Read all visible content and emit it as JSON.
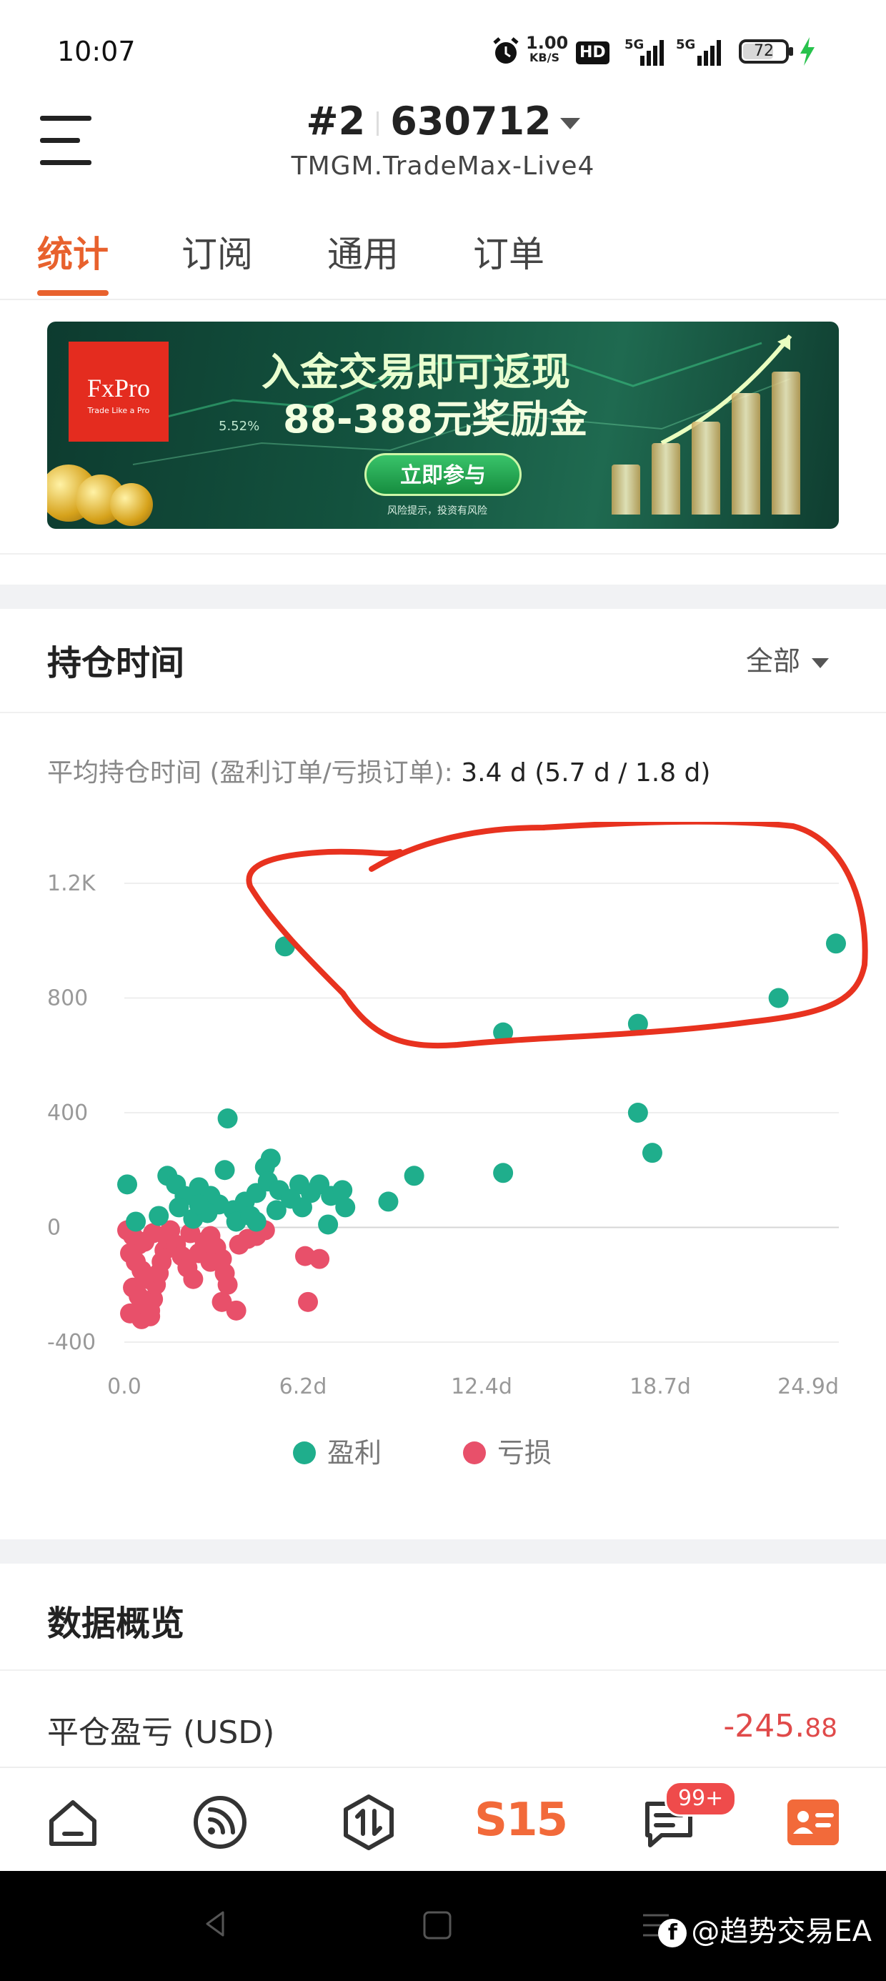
{
  "status_bar": {
    "time": "10:07",
    "net_speed_top": "1.00",
    "net_speed_unit": "KB/S",
    "hd_label": "HD",
    "signal1_label": "5G",
    "signal2_label": "5G",
    "battery": "72",
    "battery_level": 0.72,
    "icons": [
      "alarm-icon",
      "hd-icon",
      "signal-icon",
      "signal-icon",
      "battery-icon",
      "charging-icon"
    ]
  },
  "header": {
    "account_prefix": "#2",
    "account_number": "630712",
    "server": "TMGM.TradeMax-Live4"
  },
  "tabs": [
    {
      "label": "统计",
      "active": true
    },
    {
      "label": "订阅",
      "active": false
    },
    {
      "label": "通用",
      "active": false
    },
    {
      "label": "订单",
      "active": false
    }
  ],
  "banner": {
    "brand": "FxPro",
    "brand_tagline": "Trade Like a Pro",
    "headline1": "入金交易即可返现",
    "headline2": "88-388元奖励金",
    "percent_text": "5.52%",
    "cta": "立即参与",
    "risk_note": "风险提示，投资有风险"
  },
  "holding_time": {
    "title": "持仓时间",
    "filter": "全部",
    "avg_label": "平均持仓时间 (盈利订单/亏损订单):",
    "avg_value": "3.4 d (5.7 d / 1.8 d)"
  },
  "chart_data": {
    "type": "scatter",
    "x_ticks": [
      "0.0",
      "6.2d",
      "12.4d",
      "18.7d",
      "24.9d"
    ],
    "y_ticks": [
      "1.2K",
      "800",
      "400",
      "0",
      "-400"
    ],
    "xlim": [
      0,
      24.9
    ],
    "ylim": [
      -400,
      1200
    ],
    "grid": true,
    "legend_position": "bottom",
    "colors": {
      "profit": "#1fae8c",
      "loss": "#e8506a",
      "annotation": "#e8321f"
    },
    "series": [
      {
        "name": "盈利",
        "points": [
          [
            5.6,
            980
          ],
          [
            13.2,
            680
          ],
          [
            17.9,
            710
          ],
          [
            22.8,
            800
          ],
          [
            24.8,
            990
          ],
          [
            17.9,
            400
          ],
          [
            18.4,
            260
          ],
          [
            13.2,
            190
          ],
          [
            10.1,
            180
          ],
          [
            9.2,
            90
          ],
          [
            3.6,
            380
          ],
          [
            0.1,
            150
          ],
          [
            3.5,
            200
          ],
          [
            5.1,
            240
          ],
          [
            4.9,
            210
          ],
          [
            1.5,
            180
          ],
          [
            1.8,
            150
          ],
          [
            2.1,
            110
          ],
          [
            2.6,
            140
          ],
          [
            3.0,
            110
          ],
          [
            3.3,
            80
          ],
          [
            3.8,
            60
          ],
          [
            4.2,
            90
          ],
          [
            4.6,
            120
          ],
          [
            5.0,
            160
          ],
          [
            5.4,
            130
          ],
          [
            6.1,
            150
          ],
          [
            6.5,
            120
          ],
          [
            6.8,
            150
          ],
          [
            7.2,
            110
          ],
          [
            7.6,
            130
          ],
          [
            7.7,
            70
          ],
          [
            6.2,
            70
          ],
          [
            7.1,
            10
          ],
          [
            1.2,
            40
          ],
          [
            1.9,
            70
          ],
          [
            2.4,
            30
          ],
          [
            2.9,
            50
          ],
          [
            3.9,
            20
          ],
          [
            4.4,
            40
          ],
          [
            5.3,
            60
          ],
          [
            0.4,
            20
          ],
          [
            2.6,
            80
          ],
          [
            4.6,
            20
          ],
          [
            5.8,
            100
          ]
        ]
      },
      {
        "name": "亏损",
        "points": [
          [
            0.1,
            -10
          ],
          [
            0.3,
            -30
          ],
          [
            0.5,
            -60
          ],
          [
            0.2,
            -90
          ],
          [
            0.4,
            -120
          ],
          [
            0.6,
            -150
          ],
          [
            0.8,
            -180
          ],
          [
            0.3,
            -210
          ],
          [
            0.5,
            -240
          ],
          [
            0.7,
            -270
          ],
          [
            0.2,
            -300
          ],
          [
            0.6,
            -320
          ],
          [
            0.9,
            -290
          ],
          [
            1.0,
            -250
          ],
          [
            1.1,
            -200
          ],
          [
            1.2,
            -160
          ],
          [
            1.3,
            -120
          ],
          [
            1.4,
            -80
          ],
          [
            1.5,
            -40
          ],
          [
            1.6,
            -10
          ],
          [
            1.8,
            -60
          ],
          [
            2.0,
            -100
          ],
          [
            2.2,
            -140
          ],
          [
            2.4,
            -180
          ],
          [
            2.6,
            -90
          ],
          [
            2.8,
            -50
          ],
          [
            3.0,
            -30
          ],
          [
            3.2,
            -70
          ],
          [
            3.4,
            -110
          ],
          [
            3.5,
            -160
          ],
          [
            3.6,
            -200
          ],
          [
            3.4,
            -260
          ],
          [
            3.9,
            -290
          ],
          [
            4.0,
            -60
          ],
          [
            4.3,
            -40
          ],
          [
            4.6,
            -30
          ],
          [
            4.9,
            -10
          ],
          [
            6.3,
            -100
          ],
          [
            6.8,
            -110
          ],
          [
            6.4,
            -260
          ],
          [
            0.9,
            -310
          ],
          [
            1.0,
            -20
          ],
          [
            2.3,
            -20
          ],
          [
            3.0,
            -120
          ],
          [
            0.7,
            -50
          ]
        ]
      }
    ],
    "annotation": "red hand-drawn circle around the high-value profit points"
  },
  "legend": {
    "profit": "盈利",
    "loss": "亏损"
  },
  "overview": {
    "title": "数据概览",
    "pnl_label": "平仓盈亏 (USD)",
    "pnl_main": "-245.",
    "pnl_cents": "88"
  },
  "bottom_nav": {
    "items": [
      "home-icon",
      "feed-icon",
      "exchange-icon",
      "s15-logo",
      "messages-icon",
      "profile-card-icon"
    ],
    "brand_text": "S15",
    "badge": "99+"
  },
  "watermark": "@趋势交易EA"
}
